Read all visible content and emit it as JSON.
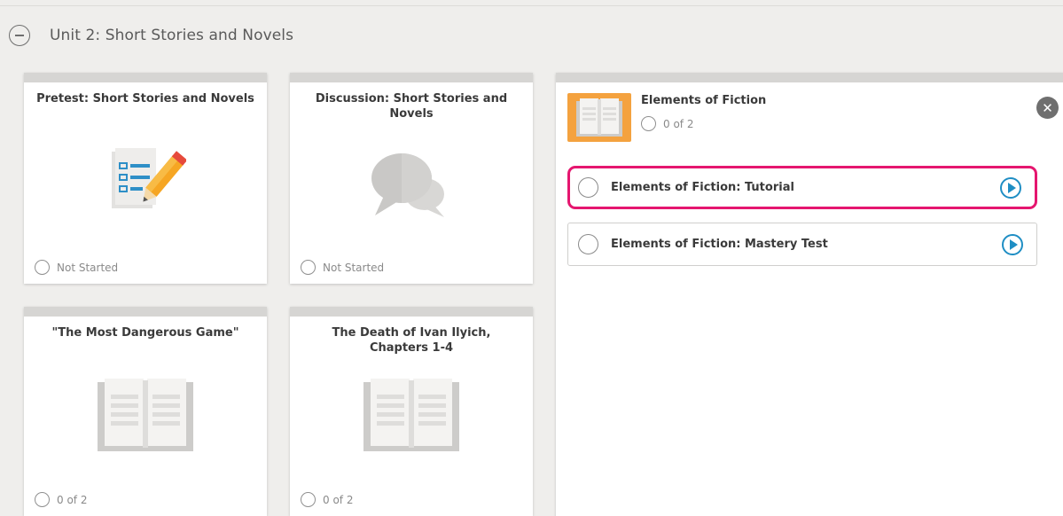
{
  "unit": {
    "title": "Unit 2: Short Stories and Novels"
  },
  "cards": [
    {
      "title": "Pretest: Short Stories and Novels",
      "status": "Not Started",
      "icon": "pretest-checklist-icon"
    },
    {
      "title": "Discussion: Short Stories and Novels",
      "status": "Not Started",
      "icon": "discussion-bubbles-icon"
    },
    {
      "title": "\"The Most Dangerous Game\"",
      "status": "0 of 2",
      "icon": "book-icon"
    },
    {
      "title": "The Death of Ivan Ilyich, Chapters 1-4",
      "status": "0 of 2",
      "icon": "book-icon"
    }
  ],
  "detail": {
    "title": "Elements of Fiction",
    "count": "0 of 2",
    "activities": [
      {
        "label": "Elements of Fiction: Tutorial",
        "selected": true
      },
      {
        "label": "Elements of Fiction: Mastery Test",
        "selected": false
      }
    ]
  },
  "colors": {
    "accent_pink": "#e5166f",
    "play_blue": "#1f8ec4",
    "thumb_orange": "#f4a23f"
  }
}
